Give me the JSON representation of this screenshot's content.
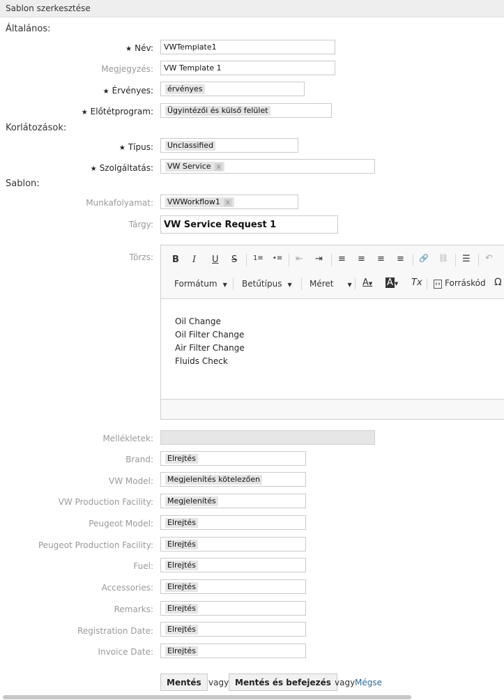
{
  "header": {
    "title": "Sablon szerkesztése"
  },
  "sections": {
    "general": "Általános:",
    "restrictions": "Korlátozások:",
    "template": "Sablon:"
  },
  "fields": {
    "name": {
      "label": "Név:",
      "value": "VWTemplate1"
    },
    "comment": {
      "label": "Megjegyzés:",
      "value": "VW Template 1"
    },
    "valid": {
      "label": "Érvényes:",
      "value": "érvényes"
    },
    "frontend": {
      "label": "Előtétprogram:",
      "value": "Ügyintézői és külső felület"
    },
    "type": {
      "label": "Típus:",
      "value": "Unclassified"
    },
    "service": {
      "label": "Szolgáltatás:",
      "value": "VW Service",
      "remove": "x"
    },
    "workflow": {
      "label": "Munkafolyamat:",
      "value": "VWWorkflow1",
      "remove": "x"
    },
    "subject": {
      "label": "Tárgy:",
      "value": "VW Service Request 1"
    },
    "body": {
      "label": "Törzs:"
    },
    "attachments": {
      "label": "Mellékletek:"
    }
  },
  "editor": {
    "format_label": "Formátum",
    "font_label": "Betűtípus",
    "size_label": "Méret",
    "source_label": "Forráskód",
    "toolbar_glyphs": {
      "bold": "B",
      "italic": "I",
      "underline": "U",
      "strike": "S",
      "numlist": "1≡",
      "bulllist": "•≡",
      "outdent": "⇤",
      "indent": "⇥",
      "align_left": "≡",
      "align_center": "≡",
      "align_right": "≡",
      "justify": "≡",
      "link": "🔗",
      "unlink": "⛓",
      "hr": "☰",
      "undo": "↶",
      "text_color": "A",
      "bg_color": "A",
      "clear_format": "Tx",
      "omega": "Ω"
    },
    "content": [
      "Oil Change",
      "Oil Filter Change",
      "Air Filter Change",
      "Fluids Check"
    ]
  },
  "dynamic_fields": [
    {
      "label": "Brand:",
      "value": "Elrejtés"
    },
    {
      "label": "VW Model:",
      "value": "Megjelenítés kötelezően"
    },
    {
      "label": "VW Production Facility:",
      "value": "Megjelenítés"
    },
    {
      "label": "Peugeot Model:",
      "value": "Elrejtés"
    },
    {
      "label": "Peugeot Production Facility:",
      "value": "Elrejtés"
    },
    {
      "label": "Fuel:",
      "value": "Elrejtés"
    },
    {
      "label": "Accessories:",
      "value": "Elrejtés"
    },
    {
      "label": "Remarks:",
      "value": "Elrejtés"
    },
    {
      "label": "Registration Date:",
      "value": "Elrejtés"
    },
    {
      "label": "Invoice Date:",
      "value": "Elrejtés"
    }
  ],
  "actions": {
    "save": "Mentés",
    "or1": "vagy",
    "save_finish": "Mentés és befejezés",
    "or2": "vagy",
    "cancel": "Mégse"
  },
  "required_marker": "★"
}
